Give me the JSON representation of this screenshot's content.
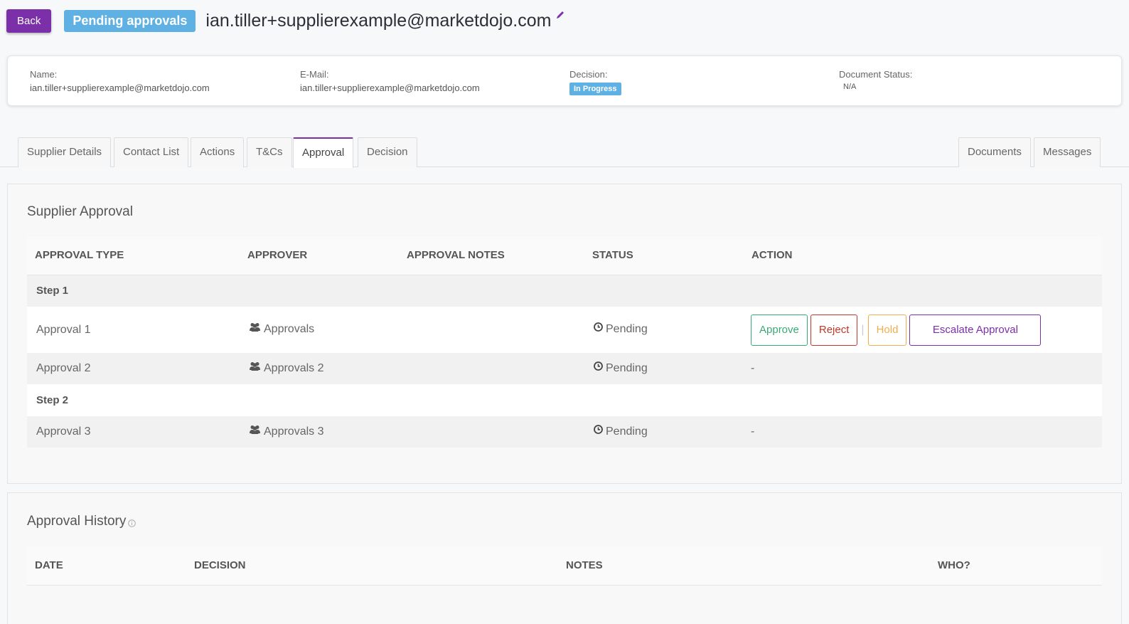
{
  "header": {
    "back_label": "Back",
    "status_badge": "Pending approvals",
    "title": "ian.tiller+supplierexample@marketdojo.com"
  },
  "info": {
    "name_label": "Name:",
    "name_value": "ian.tiller+supplierexample@marketdojo.com",
    "email_label": "E-Mail:",
    "email_value": "ian.tiller+supplierexample@marketdojo.com",
    "decision_label": "Decision:",
    "decision_value": "In Progress",
    "doc_status_label": "Document Status:",
    "doc_status_value": "N/A"
  },
  "tabs": {
    "left": [
      "Supplier Details",
      "Contact List",
      "Actions",
      "T&Cs",
      "Approval",
      "Decision"
    ],
    "right": [
      "Documents",
      "Messages"
    ],
    "active": "Approval"
  },
  "approval": {
    "title": "Supplier Approval",
    "columns": [
      "APPROVAL TYPE",
      "APPROVER",
      "APPROVAL NOTES",
      "STATUS",
      "ACTION"
    ],
    "steps": [
      {
        "label": "Step 1",
        "rows": [
          {
            "type": "Approval 1",
            "approver": "Approvals",
            "notes": "",
            "status": "Pending",
            "action": "buttons"
          },
          {
            "type": "Approval 2",
            "approver": "Approvals 2",
            "notes": "",
            "status": "Pending",
            "action": "-"
          }
        ]
      },
      {
        "label": "Step 2",
        "rows": [
          {
            "type": "Approval 3",
            "approver": "Approvals 3",
            "notes": "",
            "status": "Pending",
            "action": "-"
          }
        ]
      }
    ],
    "buttons": {
      "approve": "Approve",
      "reject": "Reject",
      "separator": "|",
      "hold": "Hold",
      "escalate": "Escalate Approval"
    }
  },
  "history": {
    "title": "Approval History",
    "columns": [
      "DATE",
      "DECISION",
      "NOTES",
      "WHO?"
    ]
  },
  "colors": {
    "primary": "#7b2fa8",
    "badge": "#5fb1e4",
    "approve": "#3aa977",
    "reject": "#c0392b",
    "hold": "#f0ad4e"
  }
}
